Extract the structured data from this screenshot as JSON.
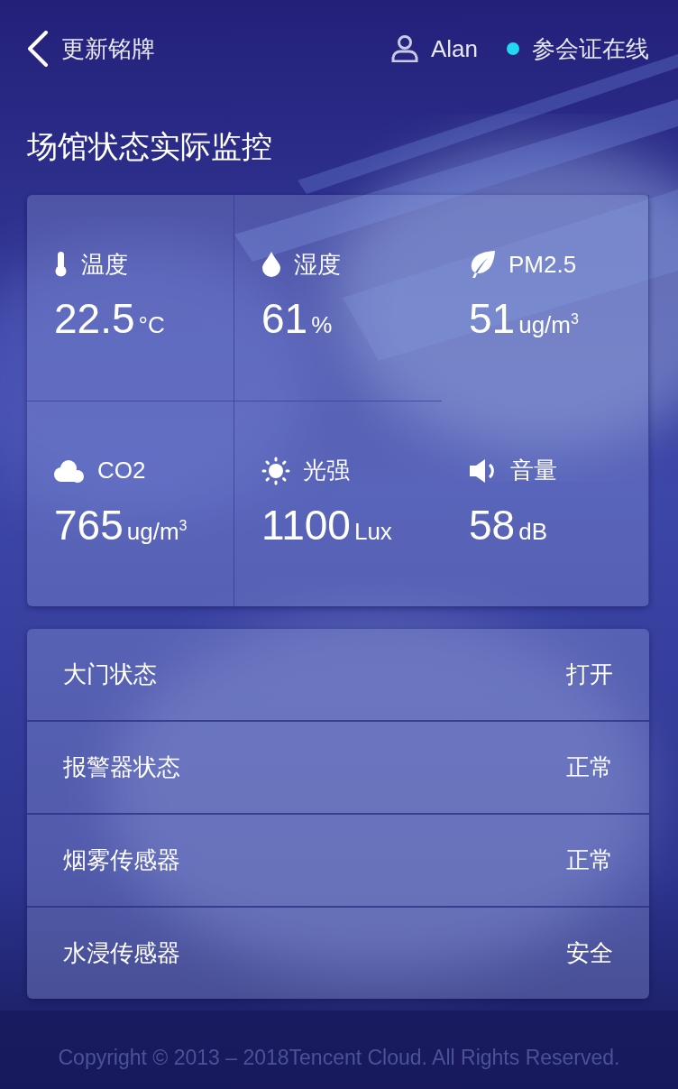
{
  "header": {
    "back_label": "更新铭牌",
    "user": "Alan",
    "status": {
      "label": "参会证在线",
      "color": "#22d8f2"
    }
  },
  "title": "场馆状态实际监控",
  "metrics": [
    {
      "label": "温度",
      "value": "22.5",
      "unit": "°C"
    },
    {
      "label": "湿度",
      "value": "61",
      "unit": "%"
    },
    {
      "label": "PM2.5",
      "value": "51",
      "unit": "ug/m$^{3}$"
    },
    {
      "label": "CO2",
      "value": "765",
      "unit": "ug/m$^{3}$"
    },
    {
      "label": "光强",
      "value": "1100",
      "unit": "Lux"
    },
    {
      "label": "音量",
      "value": "58",
      "unit": "dB"
    }
  ],
  "statuses": [
    {
      "name": "大门状态",
      "value": "打开"
    },
    {
      "name": "报警器状态",
      "value": "正常"
    },
    {
      "name": "烟雾传感器",
      "value": "正常"
    },
    {
      "name": "水浸传感器",
      "value": "安全"
    }
  ],
  "footer": "Copyright © 2013 – 2018Tencent Cloud. All Rights Reserved."
}
